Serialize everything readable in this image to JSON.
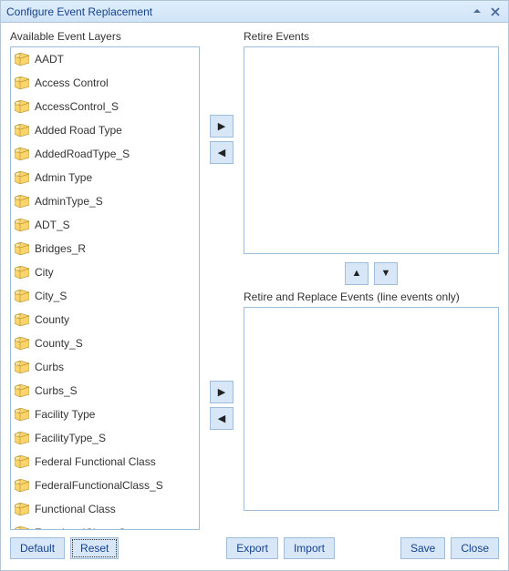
{
  "window": {
    "title": "Configure Event Replacement"
  },
  "labels": {
    "available": "Available Event Layers",
    "retire": "Retire Events",
    "retire_replace": "Retire and Replace Events (line events only)"
  },
  "available_layers": [
    "AADT",
    "Access Control",
    "AccessControl_S",
    "Added Road Type",
    "AddedRoadType_S",
    "Admin Type",
    "AdminType_S",
    "ADT_S",
    "Bridges_R",
    "City",
    "City_S",
    "County",
    "County_S",
    "Curbs",
    "Curbs_S",
    "Facility Type",
    "FacilityType_S",
    "Federal Functional Class",
    "FederalFunctionalClass_S",
    "Functional Class",
    "FunctionalClass_S"
  ],
  "retire_events": [],
  "retire_replace_events": [],
  "buttons": {
    "default": "Default",
    "reset": "Reset",
    "export": "Export",
    "import": "Import",
    "save": "Save",
    "close": "Close"
  },
  "arrows": {
    "right": "▶",
    "left": "◀",
    "up": "▲",
    "down": "▼"
  }
}
